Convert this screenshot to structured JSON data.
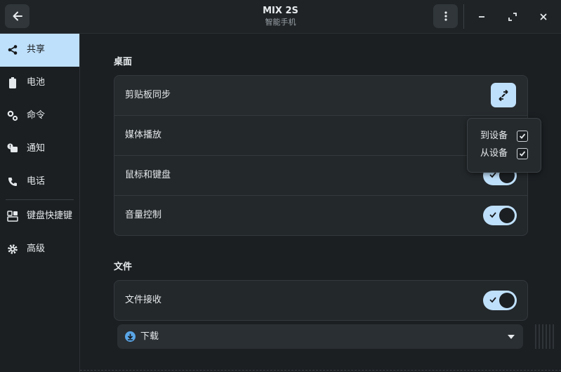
{
  "window": {
    "title": "MIX 2S",
    "subtitle": "智能手机"
  },
  "sidebar": {
    "items": [
      {
        "label": "共享",
        "icon": "share-icon",
        "active": true
      },
      {
        "label": "电池",
        "icon": "battery-icon",
        "active": false
      },
      {
        "label": "命令",
        "icon": "commands-icon",
        "active": false
      },
      {
        "label": "通知",
        "icon": "notification-icon",
        "active": false
      },
      {
        "label": "电话",
        "icon": "phone-icon",
        "active": false
      },
      {
        "label": "键盘快捷键",
        "icon": "keyboard-shortcuts-icon",
        "active": false
      },
      {
        "label": "高级",
        "icon": "gear-icon",
        "active": false
      }
    ]
  },
  "desktop_section": {
    "title": "桌面",
    "rows": [
      {
        "label": "剪贴板同步",
        "control": "sync-button"
      },
      {
        "label": "媒体播放",
        "control": "toggle",
        "on": true
      },
      {
        "label": "鼠标和键盘",
        "control": "toggle",
        "on": true
      },
      {
        "label": "音量控制",
        "control": "toggle",
        "on": true
      }
    ]
  },
  "clipboard_popover": {
    "to_device": {
      "label": "到设备",
      "checked": true
    },
    "from_device": {
      "label": "从设备",
      "checked": true
    }
  },
  "files_section": {
    "title": "文件",
    "receive": {
      "label": "文件接收",
      "on": true
    },
    "folder": {
      "label": "下载"
    }
  },
  "colors": {
    "accent": "#bfe0fb",
    "background": "#1b1f22",
    "card": "#23282b",
    "download_icon": "#5aa6e8"
  }
}
